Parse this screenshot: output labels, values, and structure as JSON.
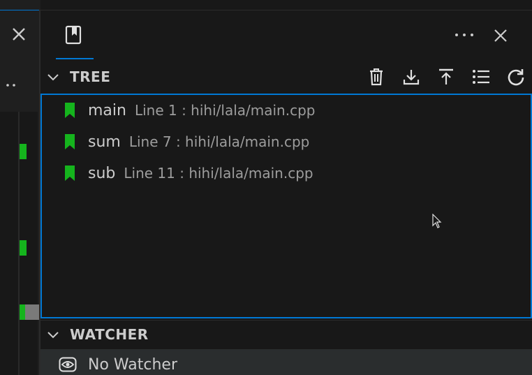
{
  "panel": {
    "tab_icon": "bookmark-book-icon",
    "more_icon": "ellipsis-icon",
    "close_icon": "close-icon"
  },
  "tree": {
    "title": "TREE",
    "actions": [
      {
        "icon": "trash-icon"
      },
      {
        "icon": "download-icon"
      },
      {
        "icon": "upload-icon"
      },
      {
        "icon": "list-icon"
      },
      {
        "icon": "refresh-icon"
      }
    ],
    "items": [
      {
        "name": "main",
        "desc": "Line 1 : hihi/lala/main.cpp"
      },
      {
        "name": "sum",
        "desc": "Line 7 : hihi/lala/main.cpp"
      },
      {
        "name": "sub",
        "desc": "Line 11 : hihi/lala/main.cpp"
      }
    ]
  },
  "watcher": {
    "title": "WATCHER",
    "empty_label": "No Watcher"
  },
  "colors": {
    "accent": "#0078d4",
    "bookmark": "#15b41d",
    "background": "#181818"
  }
}
